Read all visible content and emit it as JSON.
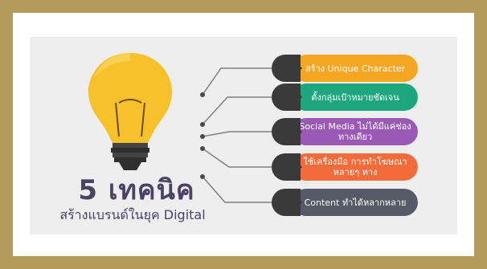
{
  "title": {
    "main": "5 เทคนิค",
    "sub": "สร้างแบรนด์ในยุค Digital"
  },
  "items": [
    {
      "label": "สร้าง Unique Character",
      "color": "#f5a623"
    },
    {
      "label": "ตั้งกลุ่มเป้าหมายชัดเจน",
      "color": "#1ea67f"
    },
    {
      "label": "Social Media ไม่ได้มีแค่ช่องทางเดียว",
      "color": "#9b59b6"
    },
    {
      "label": "ใช้เครื่องมือ การทำโฆษณาหลายๆ ทาง",
      "color": "#f26b3a"
    },
    {
      "label": "Content ทำได้หลากหลาย",
      "color": "#555a66"
    }
  ],
  "colors": {
    "frame": "#b59a5e",
    "bulb": "#f7c12c",
    "title": "#4a4366"
  }
}
